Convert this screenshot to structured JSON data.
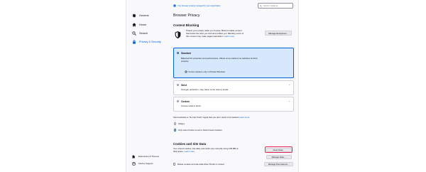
{
  "sidebar": {
    "items": [
      {
        "label": "General",
        "icon": "gear-icon"
      },
      {
        "label": "Home",
        "icon": "home-icon"
      },
      {
        "label": "Search",
        "icon": "search-icon"
      },
      {
        "label": "Privacy & Security",
        "icon": "lock-icon",
        "active": true
      }
    ],
    "footer": [
      {
        "label": "Extensions & Themes",
        "icon": "puzzle-icon"
      },
      {
        "label": "Firefox Support",
        "icon": "help-icon"
      }
    ]
  },
  "managed_notice": "Your browser is being managed by your organization",
  "find": {
    "placeholder": "Find in Options"
  },
  "page_title": "Browser Privacy",
  "content_blocking": {
    "heading": "Content Blocking",
    "desc_line1": "Protect your privacy while you browse. Block invisible content",
    "desc_line2": "that tracks the sites you visit and profiles you. Blocking some of",
    "desc_line3": "this content may make pages load faster.",
    "learn_more": "Learn more",
    "manage_exceptions": "Manage Exceptions...",
    "options": [
      {
        "title": "Standard",
        "desc1": "Balanced for protection and performance. Allows some trackers so websites function",
        "desc2": "properly.",
        "note": "Known trackers only in Private Windows",
        "selected": true
      },
      {
        "title": "Strict",
        "desc1": "Stronger protection, may cause some sites to break.",
        "selected": false
      },
      {
        "title": "Custom",
        "desc1": "Choose what to block.",
        "selected": false
      }
    ]
  },
  "dnt": {
    "text": "Send websites a “Do Not Track” signal that you don’t want to be tracked",
    "learn_more": "Learn more",
    "options": [
      {
        "label": "Always",
        "selected": false
      },
      {
        "label": "Only when Firefox is set to block known trackers",
        "selected": true
      }
    ]
  },
  "cookies": {
    "heading": "Cookies and Site Data",
    "desc_line1": "Your stored cookies, site data, and cache are currently using 108 MB of",
    "desc_line2": "disk space.",
    "learn_more": "Learn more",
    "clear_data": "Clear Data...",
    "manage_data": "Manage Data...",
    "manage_permissions": "Manage Permissions...",
    "delete_on_close": "Delete cookies and site data when Firefox is closed"
  },
  "colors": {
    "accent": "#0061e0",
    "selected_bg": "#d6e8fc",
    "highlight": "#e22850"
  }
}
